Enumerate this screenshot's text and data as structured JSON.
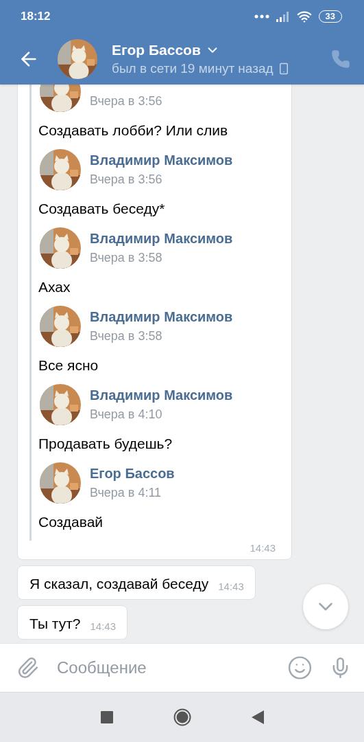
{
  "status_bar": {
    "time": "18:12",
    "battery": "33"
  },
  "header": {
    "name": "Егор Бассов",
    "status": "был в сети 19 минут назад"
  },
  "forwarded_message": {
    "items": [
      {
        "time": "Вчера в 3:56",
        "text": "Создавать лобби? Или слив"
      },
      {
        "author": "Владимир Максимов",
        "time": "Вчера в 3:56",
        "text": "Создавать беседу*"
      },
      {
        "author": "Владимир Максимов",
        "time": "Вчера в 3:58",
        "text": "Ахах"
      },
      {
        "author": "Владимир Максимов",
        "time": "Вчера в 3:58",
        "text": "Все ясно"
      },
      {
        "author": "Владимир Максимов",
        "time": "Вчера в 4:10",
        "text": "Продавать будешь?"
      },
      {
        "author": "Егор Бассов",
        "time": "Вчера в 4:11",
        "text": "Создавай"
      }
    ],
    "time": "14:43"
  },
  "messages": [
    {
      "text": "Я сказал, создавай беседу",
      "time": "14:43"
    },
    {
      "text": "Ты тут?",
      "time": "14:43"
    }
  ],
  "composer": {
    "placeholder": "Сообщение"
  }
}
